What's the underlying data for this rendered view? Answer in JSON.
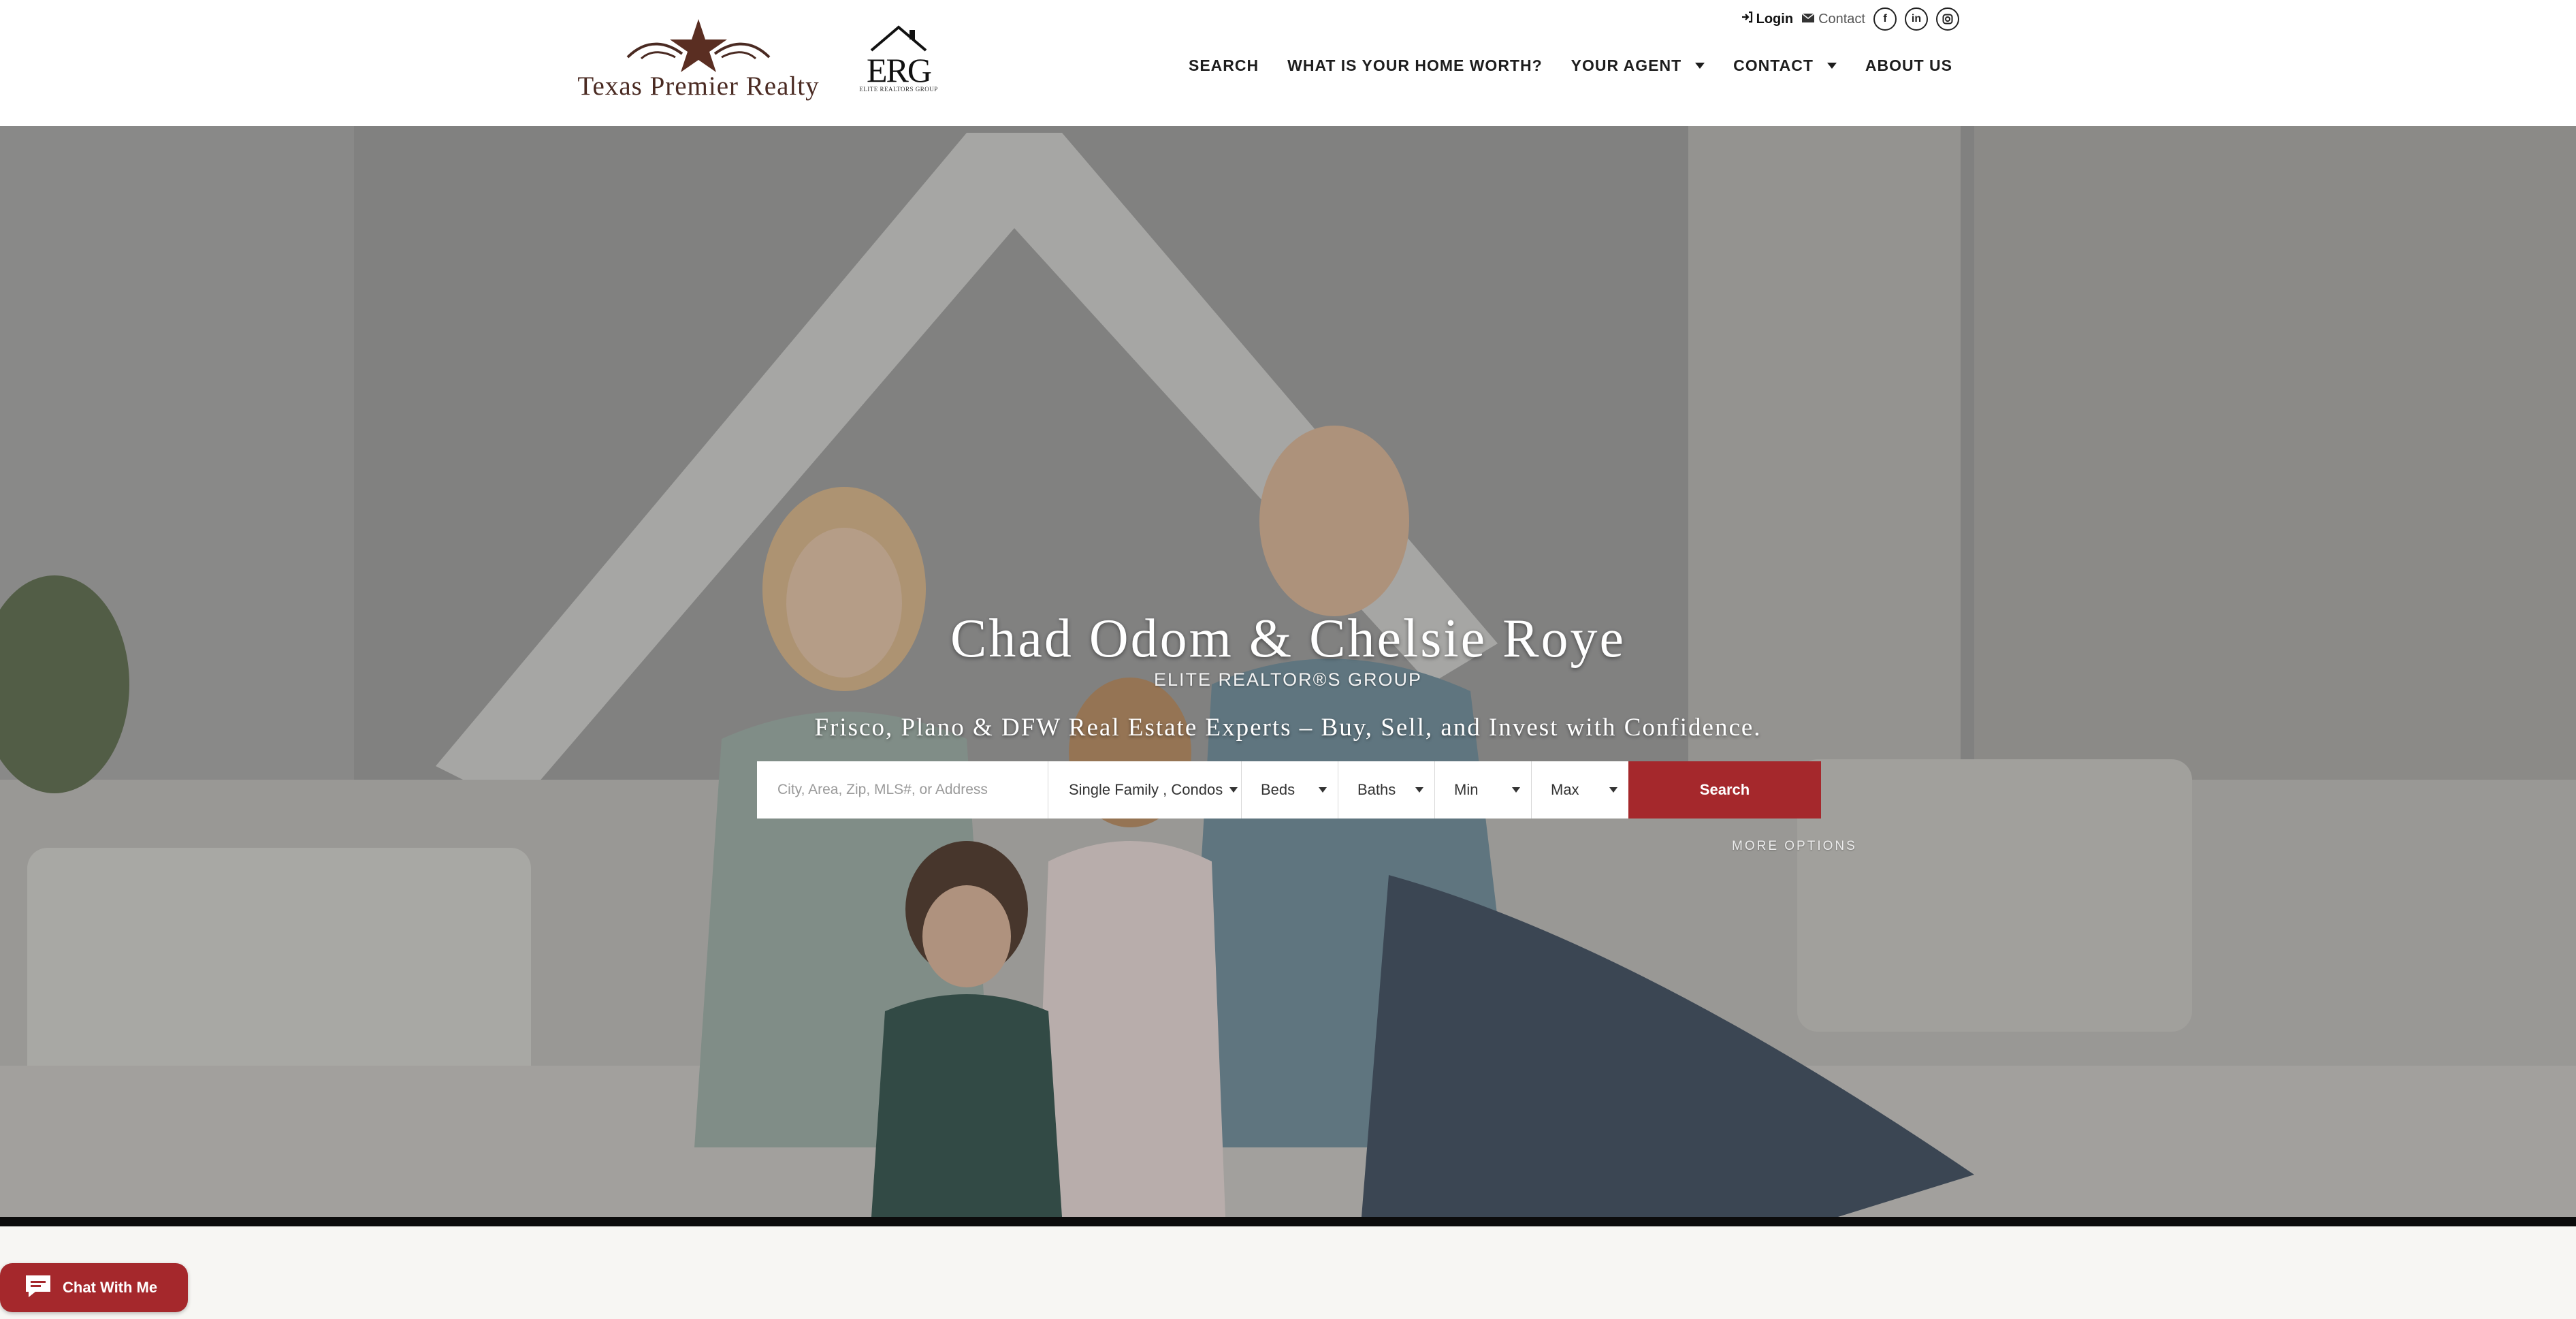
{
  "header": {
    "brand_name": "Texas Premier Realty",
    "erg_letters": "ERG",
    "erg_subtext": "ELITE REALTORS GROUP",
    "utility": {
      "login_label": "Login",
      "contact_label": "Contact",
      "social_icons": [
        "facebook-icon",
        "linkedin-icon",
        "instagram-icon"
      ]
    },
    "nav": {
      "search": "SEARCH",
      "home_worth": "WHAT IS YOUR HOME WORTH?",
      "your_agent": "YOUR AGENT",
      "contact": "CONTACT",
      "about": "ABOUT US"
    }
  },
  "hero": {
    "title": "Chad Odom & Chelsie Roye",
    "subtitle": "ELITE REALTOR®S GROUP",
    "tagline": "Frisco, Plano & DFW Real Estate Experts – Buy, Sell, and Invest with Confidence.",
    "search": {
      "placeholder": "City, Area, Zip, MLS#, or Address",
      "property_type": "Single Family , Condos",
      "beds": "Beds",
      "baths": "Baths",
      "min": "Min",
      "max": "Max",
      "button_label": "Search",
      "more_options": "MORE OPTIONS"
    }
  },
  "chat": {
    "label": "Chat With Me"
  },
  "colors": {
    "accent": "#a5282c",
    "brand_text": "#4a2a22",
    "nav_text": "#1d1d1d"
  }
}
